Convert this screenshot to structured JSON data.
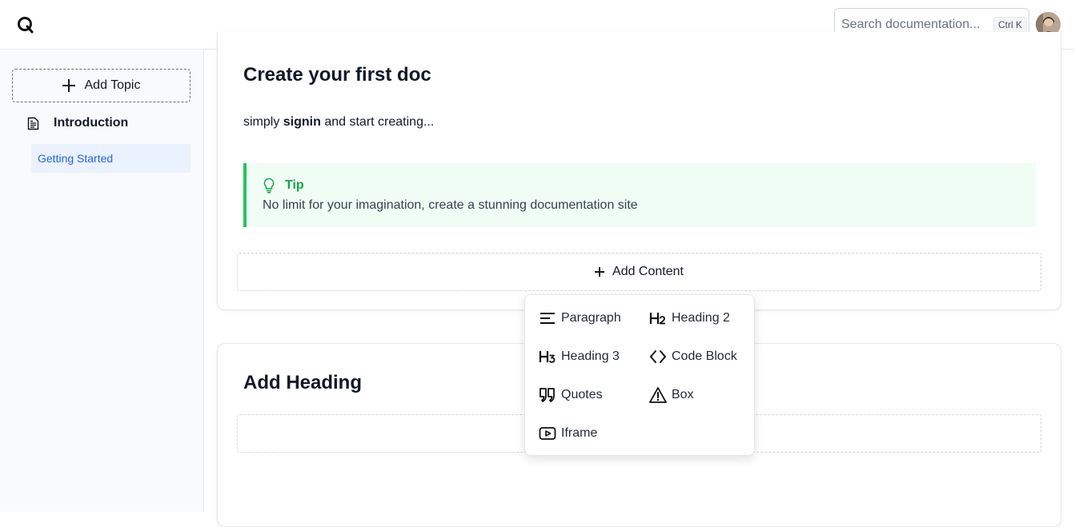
{
  "header": {
    "logo": "Q",
    "search_placeholder": "Search documentation...",
    "search_shortcut": "Ctrl K"
  },
  "sidebar": {
    "add_topic_label": "Add Topic",
    "topic_label": "Introduction",
    "sub_item_label": "Getting Started"
  },
  "main": {
    "section1_title": "Create your first doc",
    "para_before": "simply ",
    "para_bold": "signin",
    "para_after": " and start creating...",
    "tip_title": "Tip",
    "tip_body": "No limit for your imagination, create a stunning documentation site",
    "add_content_label": "Add Content",
    "section2_title": "Add Heading"
  },
  "content_menu": {
    "items": [
      {
        "label": "Paragraph",
        "icon": "paragraph-icon"
      },
      {
        "label": "Heading 2",
        "icon": "heading-2-icon"
      },
      {
        "label": "Heading 3",
        "icon": "heading-3-icon"
      },
      {
        "label": "Code Block",
        "icon": "code-icon"
      },
      {
        "label": "Quotes",
        "icon": "quote-icon"
      },
      {
        "label": "Box",
        "icon": "warning-icon"
      },
      {
        "label": "Iframe",
        "icon": "video-icon"
      }
    ]
  },
  "colors": {
    "accent_blue": "#2563eb",
    "tip_green": "#16a34a",
    "tip_bg": "#f0fdf4"
  }
}
